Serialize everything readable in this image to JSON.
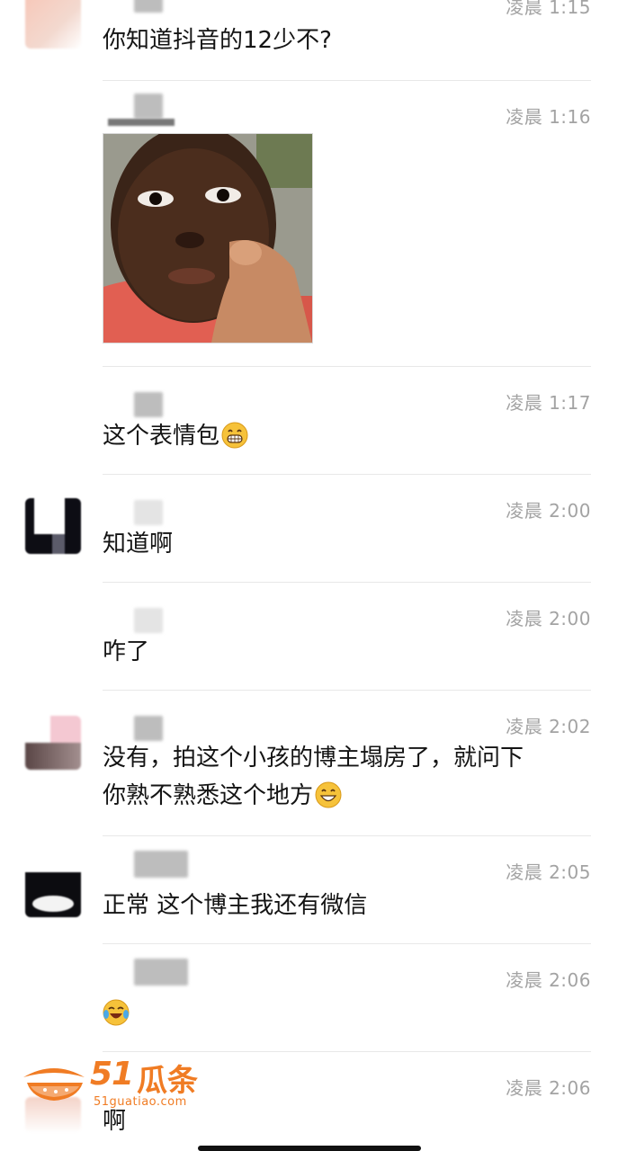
{
  "messages": [
    {
      "time": "凌晨 1:15",
      "text": "你知道抖音的12少不?"
    },
    {
      "time": "凌晨 1:16",
      "image": "meme-photo-child"
    },
    {
      "time": "凌晨 1:17",
      "text": "这个表情包",
      "emoji": "grinning-teeth-emoji"
    },
    {
      "time": "凌晨 2:00",
      "text": "知道啊"
    },
    {
      "time": "凌晨 2:00",
      "text": "咋了"
    },
    {
      "time": "凌晨 2:02",
      "line1": "没有，拍这个小孩的博主塌房了，就问下",
      "line2": "你熟不熟悉这个地方",
      "emoji": "grin-emoji"
    },
    {
      "time": "凌晨 2:05",
      "text": "正常 这个博主我还有微信"
    },
    {
      "time": "凌晨 2:06",
      "emoji": "tears-of-joy-emoji"
    },
    {
      "time": "凌晨 2:06",
      "text": "啊"
    }
  ],
  "watermark": {
    "number": "51",
    "brand": "瓜条",
    "url": "51guatiao.com"
  },
  "colors": {
    "accent": "#f07c24",
    "text": "#141414",
    "time": "#a3a3a3"
  }
}
